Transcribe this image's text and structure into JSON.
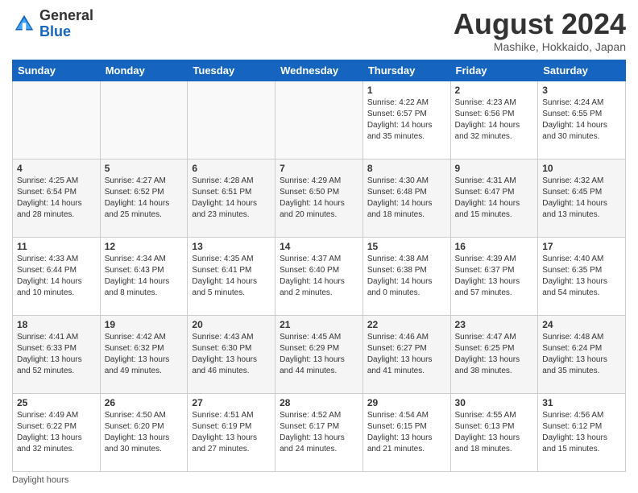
{
  "header": {
    "logo_line1": "General",
    "logo_line2": "Blue",
    "month_title": "August 2024",
    "location": "Mashike, Hokkaido, Japan"
  },
  "days_of_week": [
    "Sunday",
    "Monday",
    "Tuesday",
    "Wednesday",
    "Thursday",
    "Friday",
    "Saturday"
  ],
  "weeks": [
    [
      {
        "day": "",
        "info": ""
      },
      {
        "day": "",
        "info": ""
      },
      {
        "day": "",
        "info": ""
      },
      {
        "day": "",
        "info": ""
      },
      {
        "day": "1",
        "info": "Sunrise: 4:22 AM\nSunset: 6:57 PM\nDaylight: 14 hours and 35 minutes."
      },
      {
        "day": "2",
        "info": "Sunrise: 4:23 AM\nSunset: 6:56 PM\nDaylight: 14 hours and 32 minutes."
      },
      {
        "day": "3",
        "info": "Sunrise: 4:24 AM\nSunset: 6:55 PM\nDaylight: 14 hours and 30 minutes."
      }
    ],
    [
      {
        "day": "4",
        "info": "Sunrise: 4:25 AM\nSunset: 6:54 PM\nDaylight: 14 hours and 28 minutes."
      },
      {
        "day": "5",
        "info": "Sunrise: 4:27 AM\nSunset: 6:52 PM\nDaylight: 14 hours and 25 minutes."
      },
      {
        "day": "6",
        "info": "Sunrise: 4:28 AM\nSunset: 6:51 PM\nDaylight: 14 hours and 23 minutes."
      },
      {
        "day": "7",
        "info": "Sunrise: 4:29 AM\nSunset: 6:50 PM\nDaylight: 14 hours and 20 minutes."
      },
      {
        "day": "8",
        "info": "Sunrise: 4:30 AM\nSunset: 6:48 PM\nDaylight: 14 hours and 18 minutes."
      },
      {
        "day": "9",
        "info": "Sunrise: 4:31 AM\nSunset: 6:47 PM\nDaylight: 14 hours and 15 minutes."
      },
      {
        "day": "10",
        "info": "Sunrise: 4:32 AM\nSunset: 6:45 PM\nDaylight: 14 hours and 13 minutes."
      }
    ],
    [
      {
        "day": "11",
        "info": "Sunrise: 4:33 AM\nSunset: 6:44 PM\nDaylight: 14 hours and 10 minutes."
      },
      {
        "day": "12",
        "info": "Sunrise: 4:34 AM\nSunset: 6:43 PM\nDaylight: 14 hours and 8 minutes."
      },
      {
        "day": "13",
        "info": "Sunrise: 4:35 AM\nSunset: 6:41 PM\nDaylight: 14 hours and 5 minutes."
      },
      {
        "day": "14",
        "info": "Sunrise: 4:37 AM\nSunset: 6:40 PM\nDaylight: 14 hours and 2 minutes."
      },
      {
        "day": "15",
        "info": "Sunrise: 4:38 AM\nSunset: 6:38 PM\nDaylight: 14 hours and 0 minutes."
      },
      {
        "day": "16",
        "info": "Sunrise: 4:39 AM\nSunset: 6:37 PM\nDaylight: 13 hours and 57 minutes."
      },
      {
        "day": "17",
        "info": "Sunrise: 4:40 AM\nSunset: 6:35 PM\nDaylight: 13 hours and 54 minutes."
      }
    ],
    [
      {
        "day": "18",
        "info": "Sunrise: 4:41 AM\nSunset: 6:33 PM\nDaylight: 13 hours and 52 minutes."
      },
      {
        "day": "19",
        "info": "Sunrise: 4:42 AM\nSunset: 6:32 PM\nDaylight: 13 hours and 49 minutes."
      },
      {
        "day": "20",
        "info": "Sunrise: 4:43 AM\nSunset: 6:30 PM\nDaylight: 13 hours and 46 minutes."
      },
      {
        "day": "21",
        "info": "Sunrise: 4:45 AM\nSunset: 6:29 PM\nDaylight: 13 hours and 44 minutes."
      },
      {
        "day": "22",
        "info": "Sunrise: 4:46 AM\nSunset: 6:27 PM\nDaylight: 13 hours and 41 minutes."
      },
      {
        "day": "23",
        "info": "Sunrise: 4:47 AM\nSunset: 6:25 PM\nDaylight: 13 hours and 38 minutes."
      },
      {
        "day": "24",
        "info": "Sunrise: 4:48 AM\nSunset: 6:24 PM\nDaylight: 13 hours and 35 minutes."
      }
    ],
    [
      {
        "day": "25",
        "info": "Sunrise: 4:49 AM\nSunset: 6:22 PM\nDaylight: 13 hours and 32 minutes."
      },
      {
        "day": "26",
        "info": "Sunrise: 4:50 AM\nSunset: 6:20 PM\nDaylight: 13 hours and 30 minutes."
      },
      {
        "day": "27",
        "info": "Sunrise: 4:51 AM\nSunset: 6:19 PM\nDaylight: 13 hours and 27 minutes."
      },
      {
        "day": "28",
        "info": "Sunrise: 4:52 AM\nSunset: 6:17 PM\nDaylight: 13 hours and 24 minutes."
      },
      {
        "day": "29",
        "info": "Sunrise: 4:54 AM\nSunset: 6:15 PM\nDaylight: 13 hours and 21 minutes."
      },
      {
        "day": "30",
        "info": "Sunrise: 4:55 AM\nSunset: 6:13 PM\nDaylight: 13 hours and 18 minutes."
      },
      {
        "day": "31",
        "info": "Sunrise: 4:56 AM\nSunset: 6:12 PM\nDaylight: 13 hours and 15 minutes."
      }
    ]
  ],
  "footer": {
    "daylight_label": "Daylight hours"
  }
}
